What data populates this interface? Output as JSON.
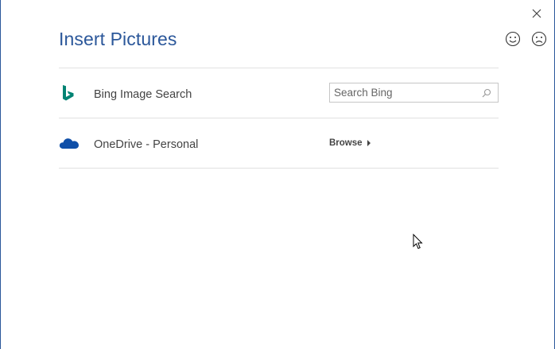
{
  "dialog": {
    "title": "Insert Pictures",
    "feedback": {
      "smile_icon": "smile-icon",
      "frown_icon": "frown-icon"
    },
    "close_icon": "close-icon"
  },
  "sources": [
    {
      "label": "Bing Image Search",
      "icon": "bing-icon",
      "search_placeholder": "Search Bing",
      "search_value": ""
    },
    {
      "label": "OneDrive - Personal",
      "icon": "onedrive-icon",
      "action_label": "Browse"
    }
  ],
  "colors": {
    "title": "#2b579a",
    "bing": "#008373",
    "onedrive": "#0f4fa8",
    "border": "#2b579a"
  }
}
